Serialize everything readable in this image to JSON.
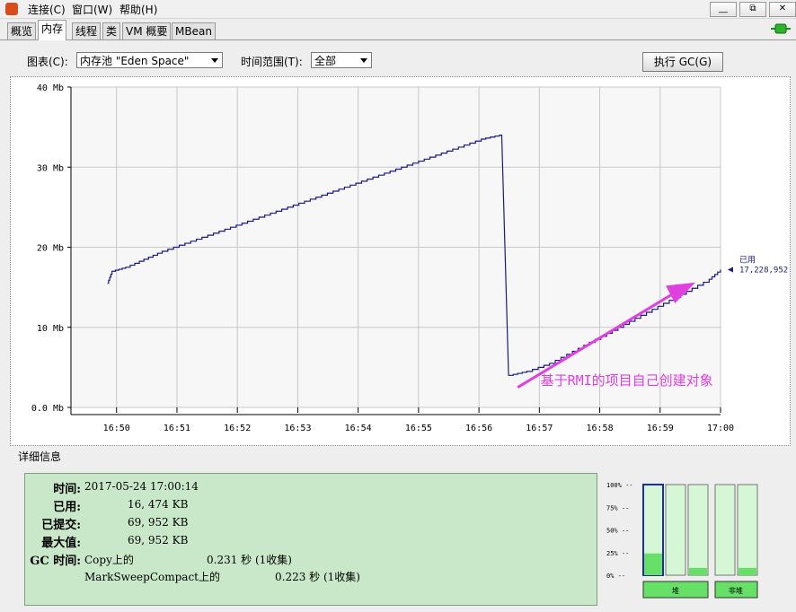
{
  "menu": {
    "connect": "连接(C)",
    "window": "窗口(W)",
    "help": "帮助(H)"
  },
  "window_buttons": {
    "minimize": "__",
    "restore": "⧉",
    "close": "✕"
  },
  "tabs": [
    "概览",
    "内存",
    "线程",
    "类",
    "VM 概要",
    "MBean"
  ],
  "toolbar": {
    "chart_label": "图表(C):",
    "chart_value": "内存池 \"Eden Space\"",
    "range_label": "时间范围(T):",
    "range_value": "全部",
    "gc_button": "执行 GC(G)"
  },
  "chart_data": {
    "type": "line",
    "y_ticks": [
      "40 Mb",
      "30 Mb",
      "20 Mb",
      "10 Mb",
      "0.0 Mb"
    ],
    "x_ticks": [
      "16:50",
      "16:51",
      "16:52",
      "16:53",
      "16:54",
      "16:55",
      "16:56",
      "16:57",
      "16:58",
      "16:59",
      "17:00"
    ],
    "ylim": [
      0,
      40
    ],
    "series": [
      {
        "name": "已用",
        "x_minutes": [
          16.8,
          16.9,
          17.2,
          17.6,
          18.0,
          18.5,
          19.0,
          19.5,
          20.0,
          20.5,
          21.0,
          21.5,
          22.0,
          22.5,
          23.0,
          23.5,
          24.0,
          24.5,
          25.0,
          25.4,
          25.45,
          25.6,
          26.0,
          26.5,
          27.0,
          27.5,
          28.0,
          28.5,
          29.0,
          29.5,
          30.0,
          30.25
        ],
        "values": [
          15.5,
          17.0,
          17.5,
          18.5,
          19.5,
          20.5,
          21.5,
          22.5,
          23.5,
          24.5,
          25.5,
          26.5,
          27.5,
          28.5,
          29.5,
          30.5,
          31.5,
          32.5,
          33.5,
          34.0,
          34.0,
          4.0,
          4.5,
          5.5,
          7.0,
          8.5,
          10.0,
          11.5,
          13.0,
          14.5,
          16.0,
          17.2
        ]
      }
    ],
    "current_label": "已用",
    "current_value": "17,228,952",
    "annotation": "基于RMI的项目自己创建对象"
  },
  "details": {
    "title": "详细信息",
    "time_label": "时间:",
    "time_value": "2017-05-24 17:00:14",
    "used_label": "已用:",
    "used_value": "16, 474 KB",
    "committed_label": "已提交:",
    "committed_value": "69, 952 KB",
    "max_label": "最大值:",
    "max_value": "69, 952 KB",
    "gc_label": "GC 时间:",
    "gc1_name": "Copy上的",
    "gc1_value": "0.231 秒 (1收集)",
    "gc2_name": "MarkSweepCompact上的",
    "gc2_value": "0.223 秒 (1收集)"
  },
  "mini_bars": {
    "ticks": [
      "100% --",
      "75% --",
      "50% --",
      "25% --",
      "0% --"
    ],
    "heap_label": "堆",
    "nonheap_label": "非堆",
    "heap_fill": [
      0.24,
      0.0,
      0.08
    ],
    "nonheap_fill": [
      0.0,
      0.08
    ]
  },
  "colors": {
    "line": "#1a1a80",
    "annotation": "#e040e0",
    "panel_green": "#c9e8c9",
    "bar_fill": "#66e066"
  }
}
